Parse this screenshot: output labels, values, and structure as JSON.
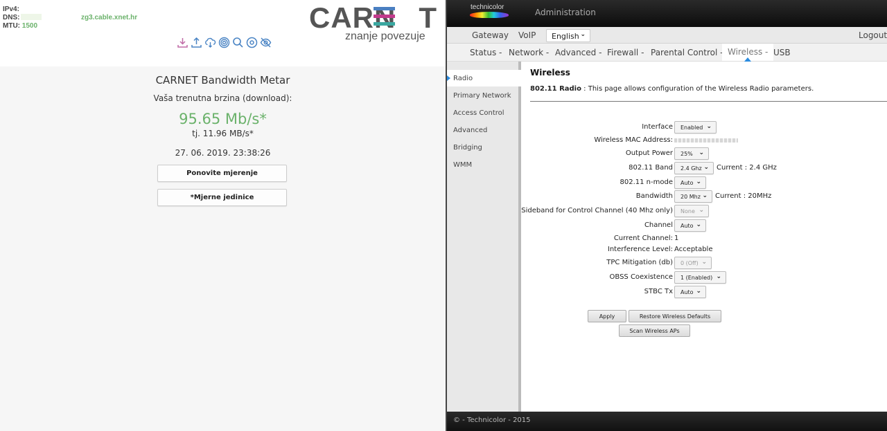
{
  "carnet": {
    "ipv4_label": "IPv4:",
    "dns_label": "DNS:",
    "mtu_label": "MTU:",
    "mtu_value": "1500",
    "host": "zg3.cable.xnet.hr",
    "logo_text": "CARN",
    "logo_end": "T",
    "logo_e_colors": [
      "#4a7fc1",
      "#c23a8c",
      "#3aa7a0"
    ],
    "slogan": "znanje povezuje",
    "tool_icons": [
      "download-icon",
      "upload-icon",
      "cloud-download-icon",
      "target-icon",
      "search-icon",
      "record-icon",
      "eye-off-icon"
    ],
    "icon_colors": [
      "#c06aa6",
      "#4a84c4",
      "#4a84c4",
      "#4a84c4",
      "#4a84c4",
      "#4a84c4",
      "#4a84c4"
    ],
    "meter": {
      "title": "CARNET Bandwidth Metar",
      "subtitle": "Vaša trenutna brzina (download):",
      "speed": "95.65 Mb/s*",
      "bytes": "tj. 11.96 MB/s*",
      "datetime": "27. 06. 2019. 23:38:26",
      "retry_button": "Ponovite mjerenje",
      "units_button": "*Mjerne jedinice"
    }
  },
  "router": {
    "brand": "technicolor",
    "admin_title": "Administration",
    "nav1": [
      "Gateway",
      "VoIP"
    ],
    "language": "English",
    "logout": "Logout",
    "nav2": [
      "Status -",
      "Network -",
      "Advanced -",
      "Firewall -",
      "Parental Control -",
      "Wireless -",
      "USB"
    ],
    "active_tab": "Wireless -",
    "sidebar": [
      "Radio",
      "Primary Network",
      "Access Control",
      "Advanced",
      "Bridging",
      "WMM"
    ],
    "page_title": "Wireless",
    "desc_bold": "802.11 Radio",
    "desc_text": ":  This page allows configuration of the Wireless Radio parameters.",
    "fields": {
      "interface": {
        "label": "Interface",
        "value": "Enabled"
      },
      "mac": {
        "label": "Wireless MAC Address:"
      },
      "output_power": {
        "label": "Output Power",
        "value": "25%"
      },
      "band": {
        "label": "802.11 Band",
        "value": "2.4 Ghz",
        "current": "Current :  2.4 GHz"
      },
      "nmode": {
        "label": "802.11 n-mode",
        "value": "Auto"
      },
      "bandwidth": {
        "label": "Bandwidth",
        "value": "20 Mhz",
        "current": "Current :  20MHz"
      },
      "sideband": {
        "label": "Sideband for Control Channel (40 Mhz only)",
        "value": "None"
      },
      "channel": {
        "label": "Channel",
        "value": "Auto"
      },
      "current_channel": {
        "label": "Current Channel:",
        "value": "1"
      },
      "interference": {
        "label": "Interference Level:",
        "value": "Acceptable"
      },
      "tpc": {
        "label": "TPC Mitigation (db)",
        "value": "0 (Off)"
      },
      "obss": {
        "label": "OBSS Coexistence",
        "value": "1 (Enabled)"
      },
      "stbc": {
        "label": "STBC Tx",
        "value": "Auto"
      }
    },
    "buttons": {
      "apply": "Apply",
      "restore": "Restore Wireless Defaults",
      "scan": "Scan Wireless APs"
    },
    "footer": "© - Technicolor - 2015"
  }
}
